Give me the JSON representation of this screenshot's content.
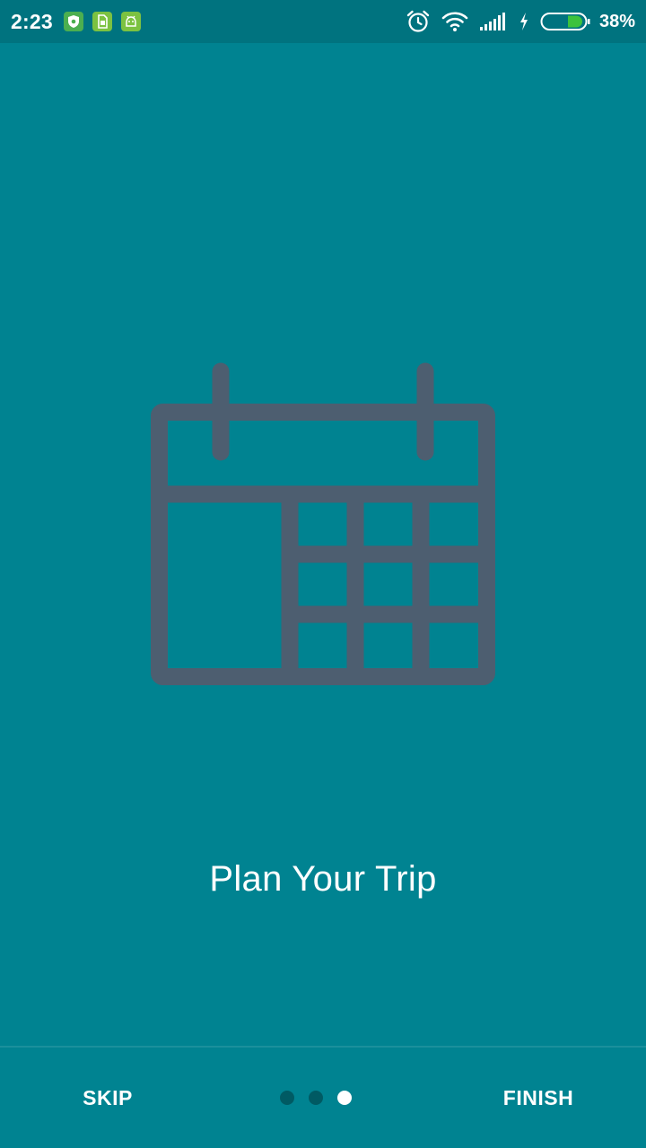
{
  "status_bar": {
    "time": "2:23",
    "notification_icons": [
      "shield-icon",
      "sim-card-icon",
      "android-icon"
    ],
    "battery_percent": "38%",
    "system_icons": [
      "alarm-clock-icon",
      "wifi-icon",
      "signal-icon",
      "charging-bolt-icon",
      "battery-icon"
    ]
  },
  "onboarding": {
    "illustration": "calendar-icon",
    "title": "Plan Your Trip",
    "page_count": 3,
    "current_page": 3
  },
  "bottom_bar": {
    "skip_label": "SKIP",
    "finish_label": "FINISH"
  },
  "colors": {
    "background": "#008391",
    "status_bar": "#00737f",
    "illustration": "#4d5e70",
    "dot_inactive": "#005a63",
    "dot_active": "#ffffff"
  }
}
